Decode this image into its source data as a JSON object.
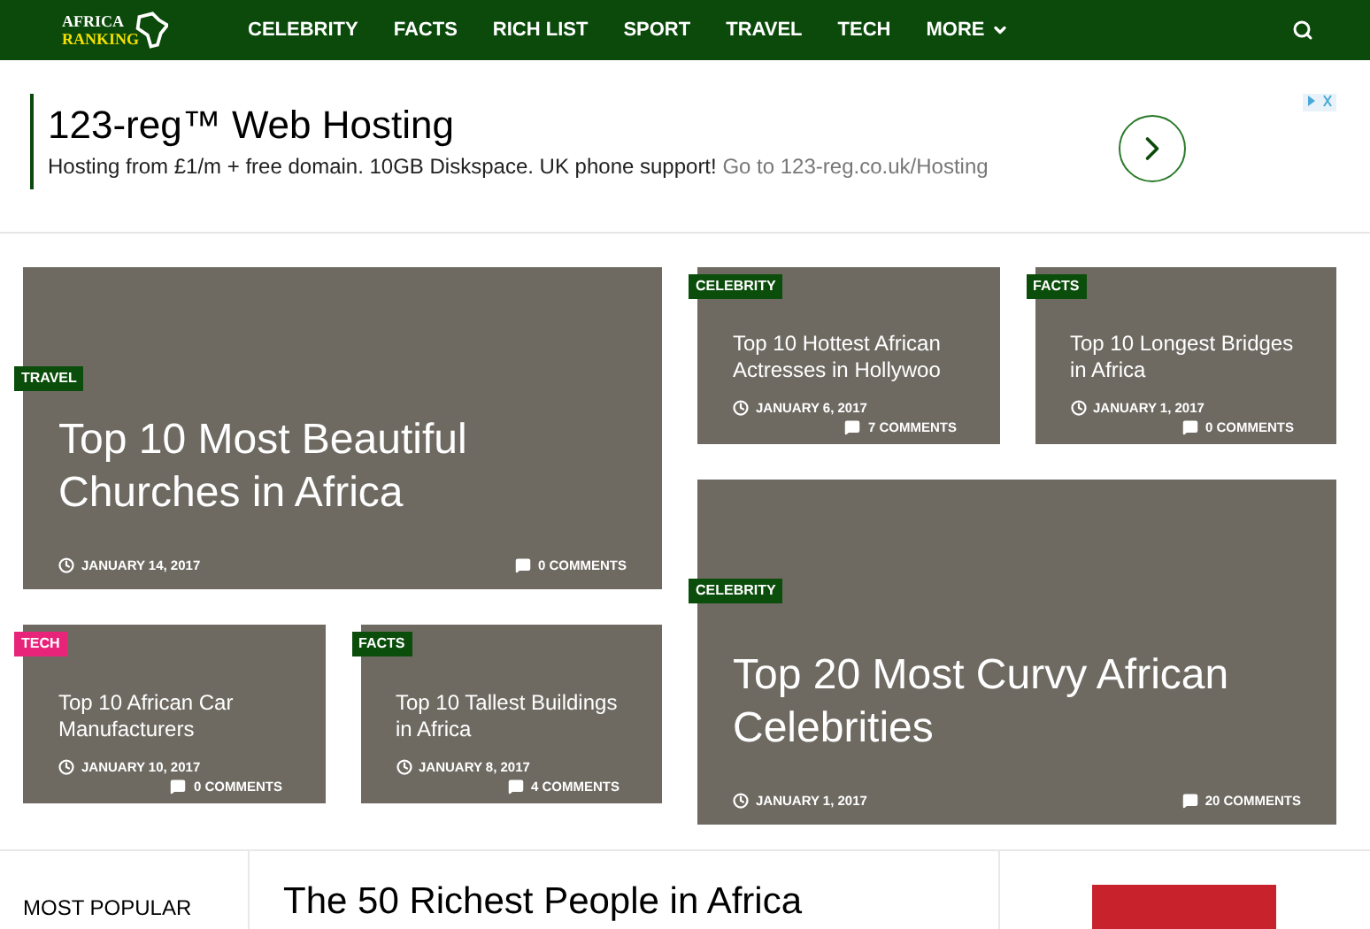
{
  "logo": {
    "line_1": "AFRICA",
    "line_2": "RANKING"
  },
  "nav": {
    "items": [
      {
        "label": "CELEBRITY",
        "dropdown": false
      },
      {
        "label": "FACTS",
        "dropdown": false
      },
      {
        "label": "RICH LIST",
        "dropdown": false
      },
      {
        "label": "SPORT",
        "dropdown": false
      },
      {
        "label": "TRAVEL",
        "dropdown": false
      },
      {
        "label": "TECH",
        "dropdown": false
      },
      {
        "label": "MORE",
        "dropdown": true
      }
    ]
  },
  "ad": {
    "title": "123-reg™ Web Hosting",
    "text": "Hosting from £1/m + free domain. 10GB Diskspace. UK phone support!",
    "link": "Go to 123-reg.co.uk/Hosting"
  },
  "featured_left": [
    {
      "kind": "large",
      "category": "TRAVEL",
      "color": "#0b4d0b",
      "title": "Top 10 Most Beautiful Churches in Africa",
      "date": "JANUARY 14, 2017",
      "comments": "0 COMMENTS"
    },
    {
      "kind": "small",
      "category": "TECH",
      "color": "#e8237a",
      "title": "Top 10 African Car Manufacturers",
      "date": "JANUARY 10, 2017",
      "comments": "0 COMMENTS"
    },
    {
      "kind": "small",
      "category": "FACTS",
      "color": "#0b4d0b",
      "title": "Top 10 Tallest Buildings in Africa",
      "date": "JANUARY 8, 2017",
      "comments": "4 COMMENTS"
    }
  ],
  "featured_right": [
    {
      "kind": "small",
      "category": "CELEBRITY",
      "color": "#0b4d0b",
      "title": "Top 10 Hottest African Actresses in Hollywoo",
      "date": "JANUARY 6, 2017",
      "comments": "7 COMMENTS"
    },
    {
      "kind": "small",
      "category": "FACTS",
      "color": "#0b4d0b",
      "title": "Top 10 Longest Bridges in Africa",
      "date": "JANUARY 1, 2017",
      "comments": "0 COMMENTS"
    },
    {
      "kind": "large",
      "category": "CELEBRITY",
      "color": "#0b4d0b",
      "title": "Top 20 Most Curvy African Celebrities",
      "date": "JANUARY 1, 2017",
      "comments": "20 COMMENTS"
    }
  ],
  "bottom": {
    "sidebar_heading": "MOST POPULAR",
    "main_heading": "The 50 Richest People in Africa"
  }
}
